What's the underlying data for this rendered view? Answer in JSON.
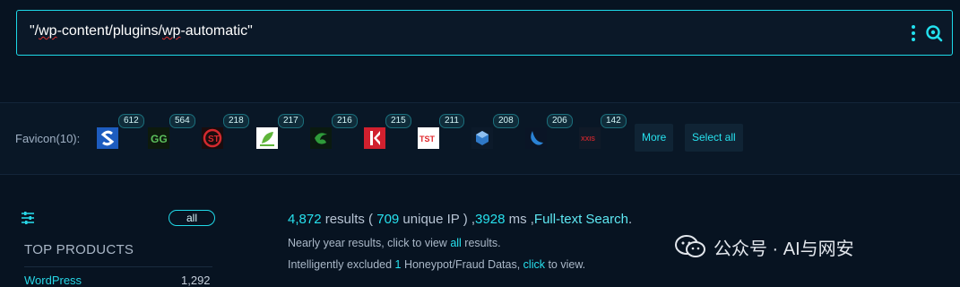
{
  "search": {
    "query_pre": "\"/",
    "query_wp1": "wp",
    "query_mid": "-content/plugins/",
    "query_wp2": "wp",
    "query_post": "-automatic\""
  },
  "favicons": {
    "label": "Favicon(10):",
    "items": [
      {
        "count": "612",
        "icon": "s-logo-icon",
        "color": "#2b6fd1"
      },
      {
        "count": "564",
        "icon": "gg-logo-icon",
        "color": "#2f6b2f"
      },
      {
        "count": "218",
        "icon": "circle-s-logo-icon",
        "color": "#c8262b"
      },
      {
        "count": "217",
        "icon": "leaf-logo-icon",
        "color": "#5fb53a"
      },
      {
        "count": "216",
        "icon": "swirl-logo-icon",
        "color": "#2e8b3a"
      },
      {
        "count": "215",
        "icon": "k-logo-icon",
        "color": "#d1202e"
      },
      {
        "count": "211",
        "icon": "tst-logo-icon",
        "color": "#e0262b"
      },
      {
        "count": "208",
        "icon": "cube-logo-icon",
        "color": "#2f79c8"
      },
      {
        "count": "206",
        "icon": "wave-logo-icon",
        "color": "#2a82d4"
      },
      {
        "count": "142",
        "icon": "text-logo-icon",
        "color": "#a31d24"
      }
    ],
    "more_label": "More",
    "select_all_label": "Select all"
  },
  "sidebar": {
    "all_label": "all",
    "top_products_title": "TOP PRODUCTS",
    "products": [
      {
        "name": "WordPress",
        "count": "1,292"
      }
    ]
  },
  "results": {
    "count": "4,872",
    "results_word": " results ( ",
    "unique_ip": "709",
    "unique_ip_word": " unique IP ) ,",
    "ms": "3928",
    "ms_word": " ms ,",
    "fulltext": "Full-text Search",
    "dot": ".",
    "line2_pre": "Nearly year results, click to view ",
    "line2_link": "all",
    "line2_post": " results.",
    "line3_pre": "Intelligently excluded ",
    "line3_num": "1",
    "line3_mid": " Honeypot/Fraud Datas, ",
    "line3_link": "click",
    "line3_post": " to view."
  },
  "watermark": {
    "text": "公众号 · AI与网安"
  }
}
